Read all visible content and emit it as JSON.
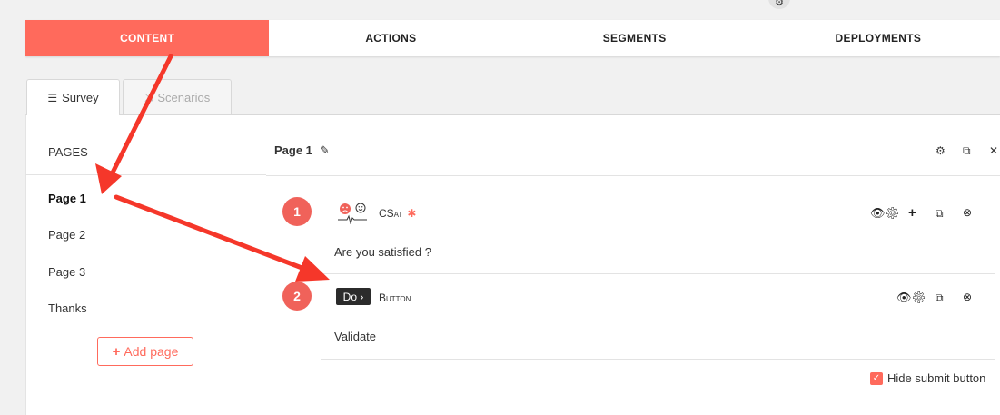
{
  "top_icon": "gear-icon",
  "main_tabs": [
    {
      "label": "CONTENT",
      "active": true
    },
    {
      "label": "ACTIONS",
      "active": false
    },
    {
      "label": "SEGMENTS",
      "active": false
    },
    {
      "label": "DEPLOYMENTS",
      "active": false
    }
  ],
  "sub_tabs": {
    "survey": "Survey",
    "scenarios": "Scenarios"
  },
  "pages_panel": {
    "title": "PAGES",
    "items": [
      "Page 1",
      "Page 2",
      "Page 3",
      "Thanks"
    ],
    "active": "Page 1",
    "add_label": "Add page"
  },
  "editor": {
    "page_title": "Page 1",
    "questions": [
      {
        "number": "1",
        "type": "CSat",
        "required": true,
        "required_mark": "✱",
        "text": "Are you satisfied ?"
      },
      {
        "number": "2",
        "badge": "Do ›",
        "type": "Button",
        "required": false,
        "text": "Validate"
      }
    ],
    "hide_submit_label": "Hide submit button",
    "hide_submit_checked": true
  },
  "colors": {
    "accent": "#ff6a5c",
    "badge": "#f0625a",
    "arrow": "#f5372a"
  }
}
